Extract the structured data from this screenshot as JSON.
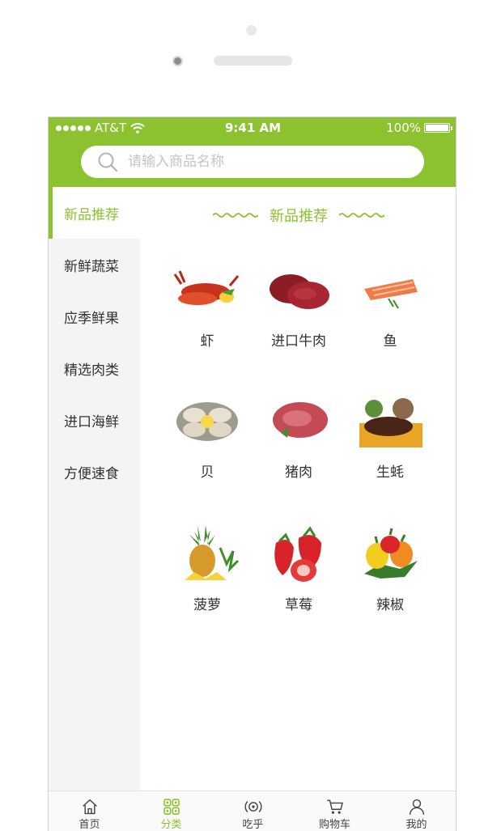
{
  "colors": {
    "accent": "#8cc22f"
  },
  "status": {
    "carrier": "AT&T",
    "time": "9:41 AM",
    "battery": "100%"
  },
  "search": {
    "placeholder": "请输入商品名称",
    "icon": "search-icon"
  },
  "sidebar": {
    "items": [
      {
        "label": "新品推荐",
        "active": true
      },
      {
        "label": "新鲜蔬菜"
      },
      {
        "label": "应季鲜果"
      },
      {
        "label": "精选肉类"
      },
      {
        "label": "进口海鲜"
      },
      {
        "label": "方便速食"
      }
    ]
  },
  "section": {
    "title": "新品推荐"
  },
  "products": [
    {
      "label": "虾",
      "icon": "shrimp"
    },
    {
      "label": "进口牛肉",
      "icon": "beef"
    },
    {
      "label": "鱼",
      "icon": "salmon"
    },
    {
      "label": "贝",
      "icon": "oyster"
    },
    {
      "label": "猪肉",
      "icon": "pork"
    },
    {
      "label": "生蚝",
      "icon": "sea-cucumber"
    },
    {
      "label": "菠萝",
      "icon": "pineapple"
    },
    {
      "label": "草莓",
      "icon": "strawberry"
    },
    {
      "label": "辣椒",
      "icon": "pepper"
    }
  ],
  "tabbar": {
    "items": [
      {
        "label": "首页",
        "icon": "home-icon"
      },
      {
        "label": "分类",
        "icon": "category-icon",
        "active": true
      },
      {
        "label": "吃乎",
        "icon": "broadcast-icon"
      },
      {
        "label": "购物车",
        "icon": "cart-icon"
      },
      {
        "label": "我的",
        "icon": "user-icon"
      }
    ]
  }
}
